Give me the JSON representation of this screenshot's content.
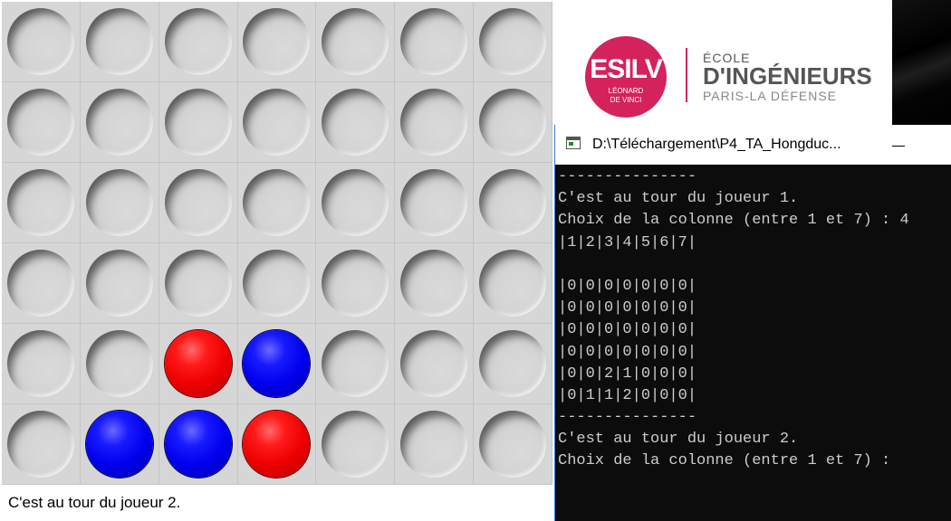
{
  "game": {
    "board": [
      [
        "empty",
        "empty",
        "empty",
        "empty",
        "empty",
        "empty",
        "empty"
      ],
      [
        "empty",
        "empty",
        "empty",
        "empty",
        "empty",
        "empty",
        "empty"
      ],
      [
        "empty",
        "empty",
        "empty",
        "empty",
        "empty",
        "empty",
        "empty"
      ],
      [
        "empty",
        "empty",
        "empty",
        "empty",
        "empty",
        "empty",
        "empty"
      ],
      [
        "empty",
        "empty",
        "red",
        "blue",
        "empty",
        "empty",
        "empty"
      ],
      [
        "empty",
        "blue",
        "blue",
        "red",
        "empty",
        "empty",
        "empty"
      ]
    ],
    "status": "C'est au tour du joueur 2."
  },
  "logo": {
    "badge_text": "ESILV",
    "badge_sub1": "LÉONARD",
    "badge_sub2": "DE VINCI",
    "line1": "ÉCOLE",
    "line2": "D'INGÉNIEURS",
    "line3": "PARIS-LA DÉFENSE",
    "brand_color": "#d4235c"
  },
  "console": {
    "title": "D:\\Téléchargement\\P4_TA_Hongduc...",
    "lines": [
      "---------------",
      "C'est au tour du joueur 1.",
      "Choix de la colonne (entre 1 et 7) : 4",
      "|1|2|3|4|5|6|7|",
      "",
      "|0|0|0|0|0|0|0|",
      "|0|0|0|0|0|0|0|",
      "|0|0|0|0|0|0|0|",
      "|0|0|0|0|0|0|0|",
      "|0|0|2|1|0|0|0|",
      "|0|1|1|2|0|0|0|",
      "---------------",
      "C'est au tour du joueur 2.",
      "Choix de la colonne (entre 1 et 7) :"
    ]
  },
  "icons": {
    "console_icon": "console-app-icon",
    "minimize": "minimize-icon"
  }
}
